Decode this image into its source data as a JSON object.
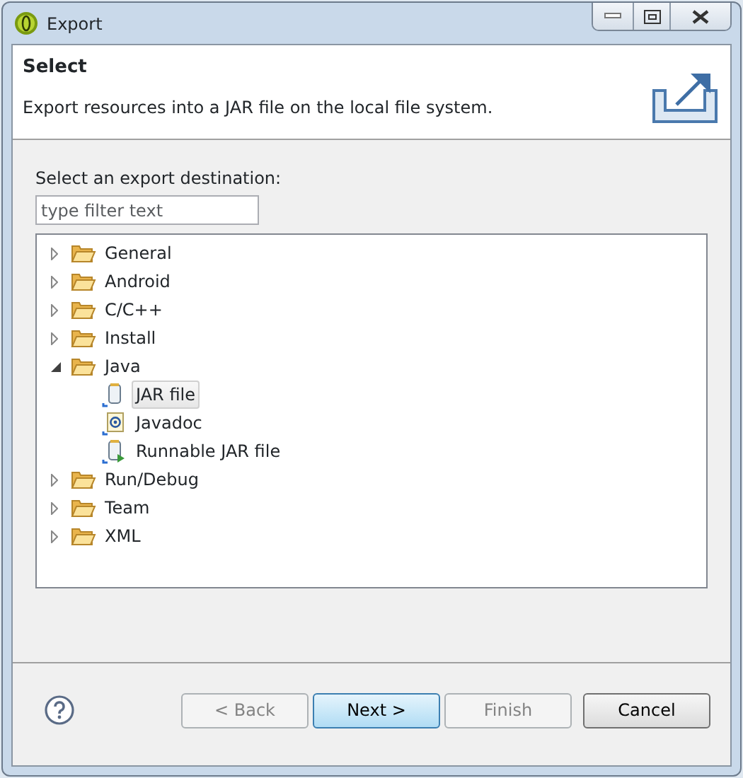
{
  "window": {
    "title": "Export"
  },
  "header": {
    "title": "Select",
    "description": "Export resources into a JAR file on the local file system."
  },
  "destination_label": "Select an export destination:",
  "filter": {
    "placeholder": "type filter text"
  },
  "tree": [
    {
      "label": "General",
      "kind": "folder",
      "expanded": false,
      "selected": false
    },
    {
      "label": "Android",
      "kind": "folder",
      "expanded": false,
      "selected": false
    },
    {
      "label": "C/C++",
      "kind": "folder",
      "expanded": false,
      "selected": false
    },
    {
      "label": "Install",
      "kind": "folder",
      "expanded": false,
      "selected": false
    },
    {
      "label": "Java",
      "kind": "folder",
      "expanded": true,
      "selected": false,
      "children": [
        {
          "label": "JAR file",
          "kind": "jar",
          "selected": true
        },
        {
          "label": "Javadoc",
          "kind": "javadoc",
          "selected": false
        },
        {
          "label": "Runnable JAR file",
          "kind": "runnable",
          "selected": false
        }
      ]
    },
    {
      "label": "Run/Debug",
      "kind": "folder",
      "expanded": false,
      "selected": false
    },
    {
      "label": "Team",
      "kind": "folder",
      "expanded": false,
      "selected": false
    },
    {
      "label": "XML",
      "kind": "folder",
      "expanded": false,
      "selected": false
    }
  ],
  "buttons": [
    {
      "label": "< Back",
      "disabled": true,
      "default": false
    },
    {
      "label": "Next >",
      "disabled": false,
      "default": true
    },
    {
      "label": "Finish",
      "disabled": true,
      "default": false
    },
    {
      "label": "Cancel",
      "disabled": false,
      "default": false
    }
  ]
}
